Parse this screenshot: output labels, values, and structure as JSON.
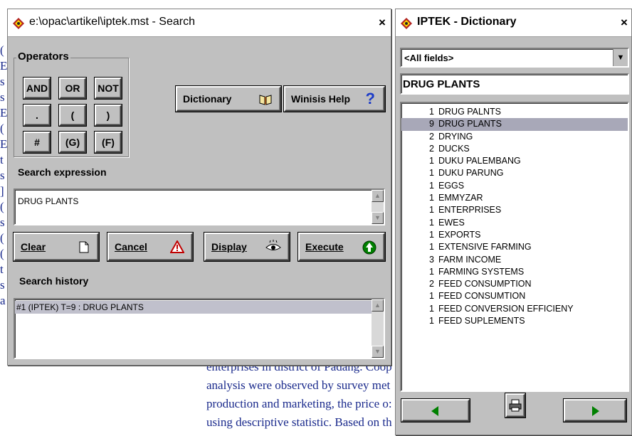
{
  "background_doc": {
    "lines": [
      "enterprises in district of Padang. Coop",
      "analysis were observed by survey met",
      "production and marketing, the price o:",
      "using descriptive statistic. Based on th"
    ]
  },
  "search_window": {
    "title": "e:\\opac\\artikel\\iptek.mst - Search",
    "close": "×",
    "operators": {
      "group_label": "Operators",
      "buttons": [
        "AND",
        "OR",
        "NOT",
        ".",
        "(",
        ")",
        "#",
        "(G)",
        "(F)"
      ]
    },
    "dictionary_button": "Dictionary",
    "help_button": "Winisis Help",
    "search_expression_label": "Search expression",
    "search_expression_value": "DRUG PLANTS",
    "actions": {
      "clear": "Clear",
      "cancel": "Cancel",
      "display": "Display",
      "execute": "Execute"
    },
    "search_history_label": "Search history",
    "history": [
      "#1 (IPTEK) T=9 : DRUG PLANTS"
    ]
  },
  "dictionary_window": {
    "title": "IPTEK - Dictionary",
    "close": "×",
    "field_select": "<All fields>",
    "term_input": "DRUG PLANTS",
    "terms": [
      {
        "count": "1",
        "term": "DRUG PALNTS"
      },
      {
        "count": "9",
        "term": "DRUG PLANTS",
        "selected": true
      },
      {
        "count": "2",
        "term": "DRYING"
      },
      {
        "count": "2",
        "term": "DUCKS"
      },
      {
        "count": "1",
        "term": "DUKU PALEMBANG"
      },
      {
        "count": "1",
        "term": "DUKU PARUNG"
      },
      {
        "count": "1",
        "term": "EGGS"
      },
      {
        "count": "1",
        "term": "EMMYZAR"
      },
      {
        "count": "1",
        "term": "ENTERPRISES"
      },
      {
        "count": "1",
        "term": "EWES"
      },
      {
        "count": "1",
        "term": "EXPORTS"
      },
      {
        "count": "1",
        "term": "EXTENSIVE FARMING"
      },
      {
        "count": "3",
        "term": "FARM INCOME"
      },
      {
        "count": "1",
        "term": "FARMING SYSTEMS"
      },
      {
        "count": "2",
        "term": "FEED CONSUMPTION"
      },
      {
        "count": "1",
        "term": "FEED CONSUMTION"
      },
      {
        "count": "1",
        "term": "FEED CONVERSION EFFICIENY"
      },
      {
        "count": "1",
        "term": "FEED SUPLEMENTS"
      }
    ]
  },
  "colors": {
    "window_face": "#c0c0c0",
    "selection": "#a8a8b8",
    "arrow_green": "#008000",
    "doc_text": "#1a2a8c"
  },
  "icons": {
    "dictionary": "book-icon",
    "help": "question-mark-icon",
    "clear": "page-icon",
    "cancel": "warning-triangle-icon",
    "display": "eye-icon",
    "execute": "green-arrow-up-icon",
    "print": "printer-icon",
    "prev": "left-arrow-icon",
    "next": "right-arrow-icon"
  }
}
